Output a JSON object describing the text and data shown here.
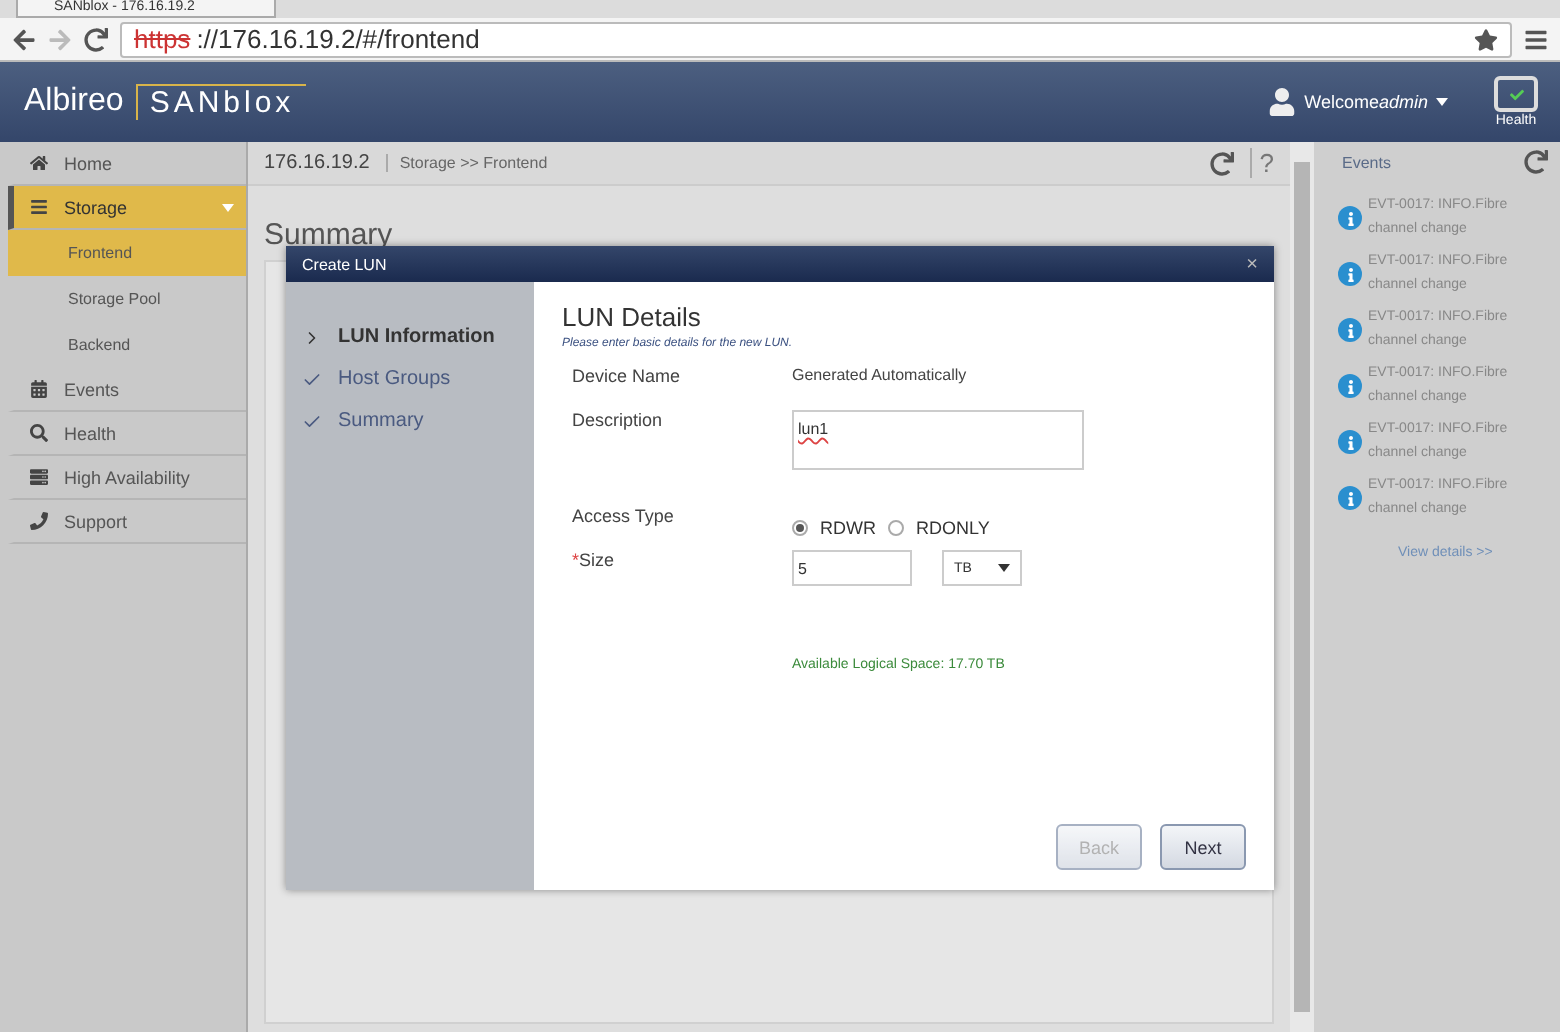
{
  "browser": {
    "tab_title": "SANblox - 176.16.19.2",
    "url_scheme": "https",
    "url_rest": "://176.16.19.2/#/frontend"
  },
  "header": {
    "logo_left": "Albireo",
    "logo_right": "SANblox",
    "welcome": "Welcome",
    "user": "admin",
    "health_label": "Health"
  },
  "sidebar": {
    "items": [
      {
        "label": "Home",
        "selected": false
      },
      {
        "label": "Storage",
        "selected": true,
        "expanded": true,
        "children": [
          {
            "label": "Frontend",
            "selected": true
          },
          {
            "label": "Storage Pool",
            "selected": false
          },
          {
            "label": "Backend",
            "selected": false
          }
        ]
      },
      {
        "label": "Events",
        "selected": false
      },
      {
        "label": "Health",
        "selected": false
      },
      {
        "label": "High Availability",
        "selected": false
      },
      {
        "label": "Support",
        "selected": false
      }
    ]
  },
  "breadcrumb": {
    "host": "176.16.19.2",
    "path": "Storage >> Frontend",
    "help": "?"
  },
  "page_title": "Summary",
  "dialog": {
    "title": "Create LUN",
    "close": "×",
    "steps": [
      {
        "label": "LUN Information",
        "selected": true
      },
      {
        "label": "Host Groups",
        "selected": false
      },
      {
        "label": "Summary",
        "selected": false
      }
    ],
    "heading": "LUN Details",
    "subtitle": "Please enter basic details for the new LUN.",
    "device_name": {
      "label": "Device Name",
      "value": "Generated Automatically"
    },
    "description": {
      "label": "Description",
      "value": "lun1"
    },
    "access_type": {
      "label": "Access Type",
      "options": [
        {
          "label": "RDWR",
          "selected": true
        },
        {
          "label": "RDONLY",
          "selected": false
        }
      ]
    },
    "size": {
      "required_mark": "*",
      "label": "Size",
      "value": "5",
      "unit": "TB"
    },
    "available": "Available Logical Space: 17.70 TB",
    "buttons": [
      {
        "label": "Back",
        "disabled": true
      },
      {
        "label": "Next",
        "disabled": false
      }
    ]
  },
  "events": {
    "title": "Events",
    "items": [
      {
        "text": "EVT-0017: INFO.Fibre channel change"
      },
      {
        "text": "EVT-0017: INFO.Fibre channel change"
      },
      {
        "text": "EVT-0017: INFO.Fibre channel change"
      },
      {
        "text": "EVT-0017: INFO.Fibre channel change"
      },
      {
        "text": "EVT-0017: INFO.Fibre channel change"
      },
      {
        "text": "EVT-0017: INFO.Fibre channel change"
      }
    ],
    "link": "View details >>"
  }
}
